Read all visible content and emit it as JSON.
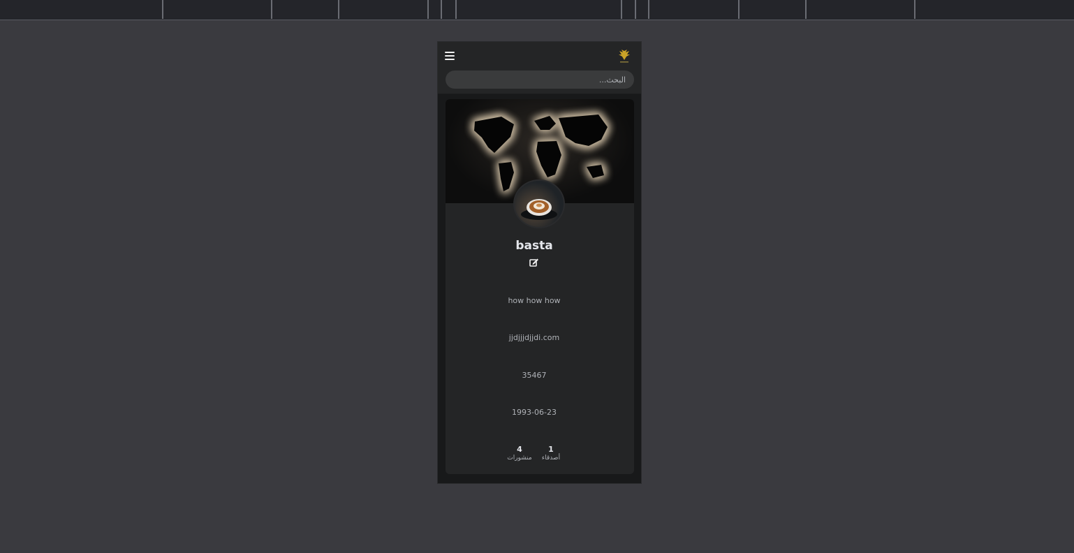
{
  "header": {
    "menu_icon": "hamburger-menu-icon",
    "logo_icon": "eagle-logo-icon"
  },
  "search": {
    "placeholder": "البحث..."
  },
  "profile": {
    "username": "basta",
    "bio": "how how how",
    "email": "jjdjjjdjjdi.com",
    "phone": "35467",
    "birthdate": "1993-06-23",
    "cover_image": "world-map-backlit-image",
    "avatar_image": "coffee-latte-art-image",
    "edit_icon": "edit-icon"
  },
  "stats": {
    "posts": {
      "count": "4",
      "label": "منشورات"
    },
    "friends": {
      "count": "1",
      "label": "أصدقاء"
    }
  },
  "colors": {
    "background": "#3a3a3f",
    "phone_bg": "#18191a",
    "card_bg": "#242526",
    "text_primary": "#e4e6eb",
    "text_secondary": "#b0b3b8"
  }
}
